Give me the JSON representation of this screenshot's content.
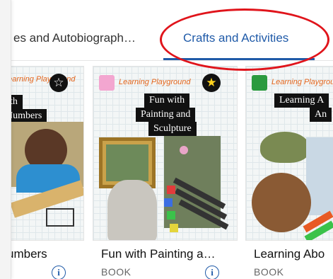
{
  "tabs": [
    {
      "label": "es and Autobiograph…"
    },
    {
      "label": "Crafts and Activities"
    }
  ],
  "series_label": "Learning Playground",
  "cards": [
    {
      "title": "umbers",
      "type": "",
      "cover_lines": [
        "with",
        "Numbers"
      ]
    },
    {
      "title": "Fun with Painting a…",
      "type": "BOOK",
      "cover_lines": [
        "Fun with",
        "Painting and",
        "Sculpture"
      ]
    },
    {
      "title": "Learning Abo",
      "type": "BOOK",
      "cover_lines": [
        "Learning A",
        "An"
      ]
    }
  ],
  "badges": {
    "empty": "☆",
    "filled": "★"
  },
  "info_icon": "i",
  "colors": {
    "accent": "#1f5aa8",
    "highlight": "#e0141b",
    "series_orange": "#e4661d"
  }
}
